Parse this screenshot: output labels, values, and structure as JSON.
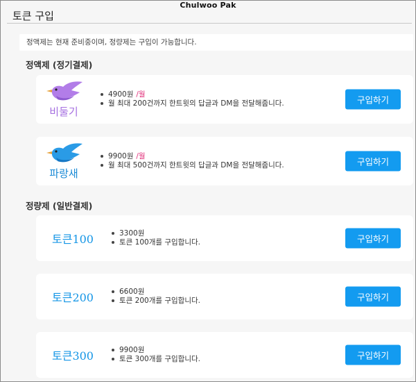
{
  "window": {
    "title": "Chulwoo Pak"
  },
  "page": {
    "title": "토큰 구입",
    "notice": "정액제는 현재 준비중이며, 정량제는 구입이 가능합니다."
  },
  "subscription": {
    "heading": "정액제 (정기결제)",
    "plans": [
      {
        "name": "비둘기",
        "icon": "pigeon-icon",
        "color": "#a56fe0",
        "price": "4900원",
        "period": "/월",
        "desc": "월 최대 200건까지 한트윗의 답글과 DM을 전달해줍니다.",
        "button": "구입하기"
      },
      {
        "name": "파랑새",
        "icon": "bluebird-icon",
        "color": "#1a8ad6",
        "price": "9900원",
        "period": "/월",
        "desc": "월 최대 500건까지 한트윗의 답글과 DM을 전달해줍니다.",
        "button": "구입하기"
      }
    ]
  },
  "prepaid": {
    "heading": "정량제 (일반결제)",
    "tokens": [
      {
        "name": "토큰100",
        "price": "3300원",
        "desc": "토큰 100개를 구입합니다.",
        "button": "구입하기"
      },
      {
        "name": "토큰200",
        "price": "6600원",
        "desc": "토큰 200개를 구입합니다.",
        "button": "구입하기"
      },
      {
        "name": "토큰300",
        "price": "9900원",
        "desc": "토큰 300개를 구입합니다.",
        "button": "구입하기"
      }
    ]
  },
  "colors": {
    "button": "#139bf0",
    "per_month": "#e0307a",
    "token_name": "#1596e6"
  }
}
